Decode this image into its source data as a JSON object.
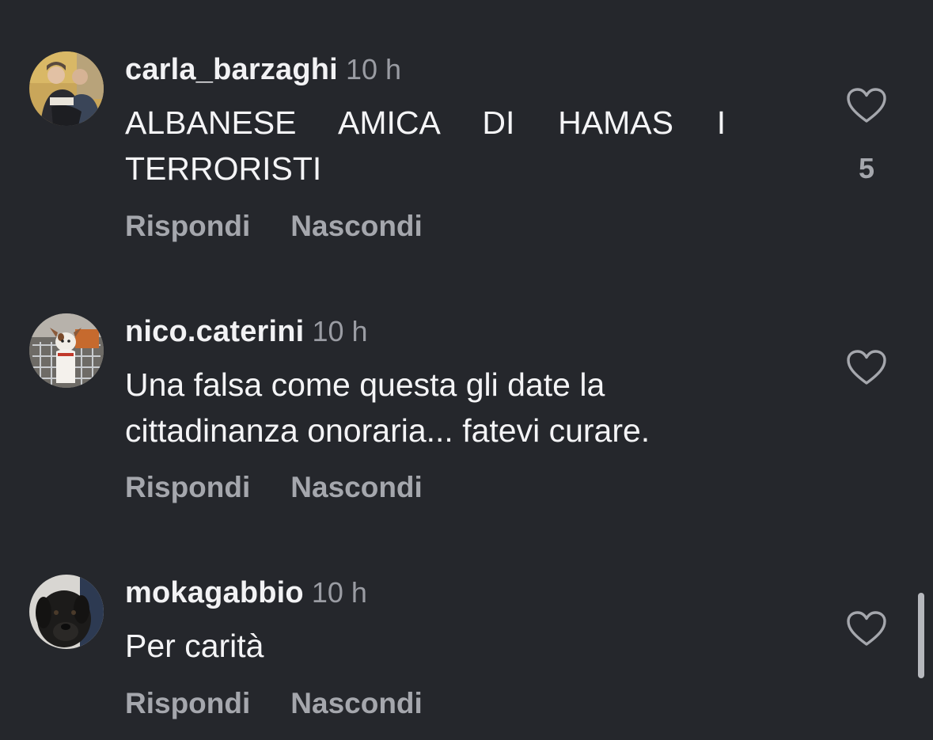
{
  "comments": [
    {
      "username": "carla_barzaghi",
      "time": "10 h",
      "text_lines": [
        "ALBANESE  AMICA  DI  HAMAS  I",
        "TERRORISTI"
      ],
      "likes": "5",
      "reply_label": "Rispondi",
      "hide_label": "Nascondi",
      "avatar_icon": "couple-photo-avatar"
    },
    {
      "username": "nico.caterini",
      "time": "10 h",
      "text_lines": [
        "Una falsa come questa gli date la",
        "cittadinanza onoraria... fatevi curare."
      ],
      "likes": "",
      "reply_label": "Rispondi",
      "hide_label": "Nascondi",
      "avatar_icon": "dog-in-cart-avatar"
    },
    {
      "username": "mokagabbio",
      "time": "10 h",
      "text_lines": [
        "Per carità"
      ],
      "likes": "",
      "reply_label": "Rispondi",
      "hide_label": "Nascondi",
      "avatar_icon": "black-dog-avatar"
    }
  ],
  "colors": {
    "background": "#25272c",
    "username": "#f2f2f4",
    "secondary": "#a5a7ad",
    "heart": "#a5a7ad"
  }
}
